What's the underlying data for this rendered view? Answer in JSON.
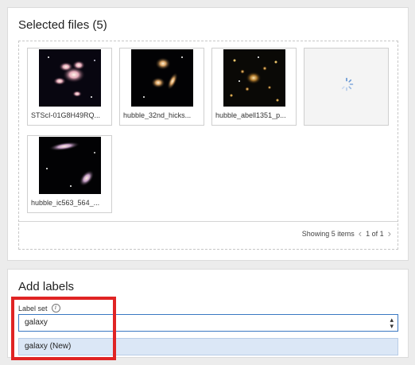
{
  "files_panel": {
    "title": "Selected files (5)",
    "tiles": [
      {
        "name": "STScI-01G8H49RQ..."
      },
      {
        "name": "hubble_32nd_hicks..."
      },
      {
        "name": "hubble_abell1351_p..."
      },
      {
        "name": ""
      },
      {
        "name": "hubble_ic563_564_..."
      }
    ],
    "pager": {
      "showing": "Showing 5 items",
      "page": "1 of 1"
    }
  },
  "labels_panel": {
    "title": "Add labels",
    "label_set": {
      "label": "Label set",
      "value": "galaxy",
      "option": "galaxy (New)"
    }
  },
  "colors": {
    "accent": "#3a78c2",
    "highlight": "#e02424",
    "option_bg": "#dbe7f6"
  }
}
